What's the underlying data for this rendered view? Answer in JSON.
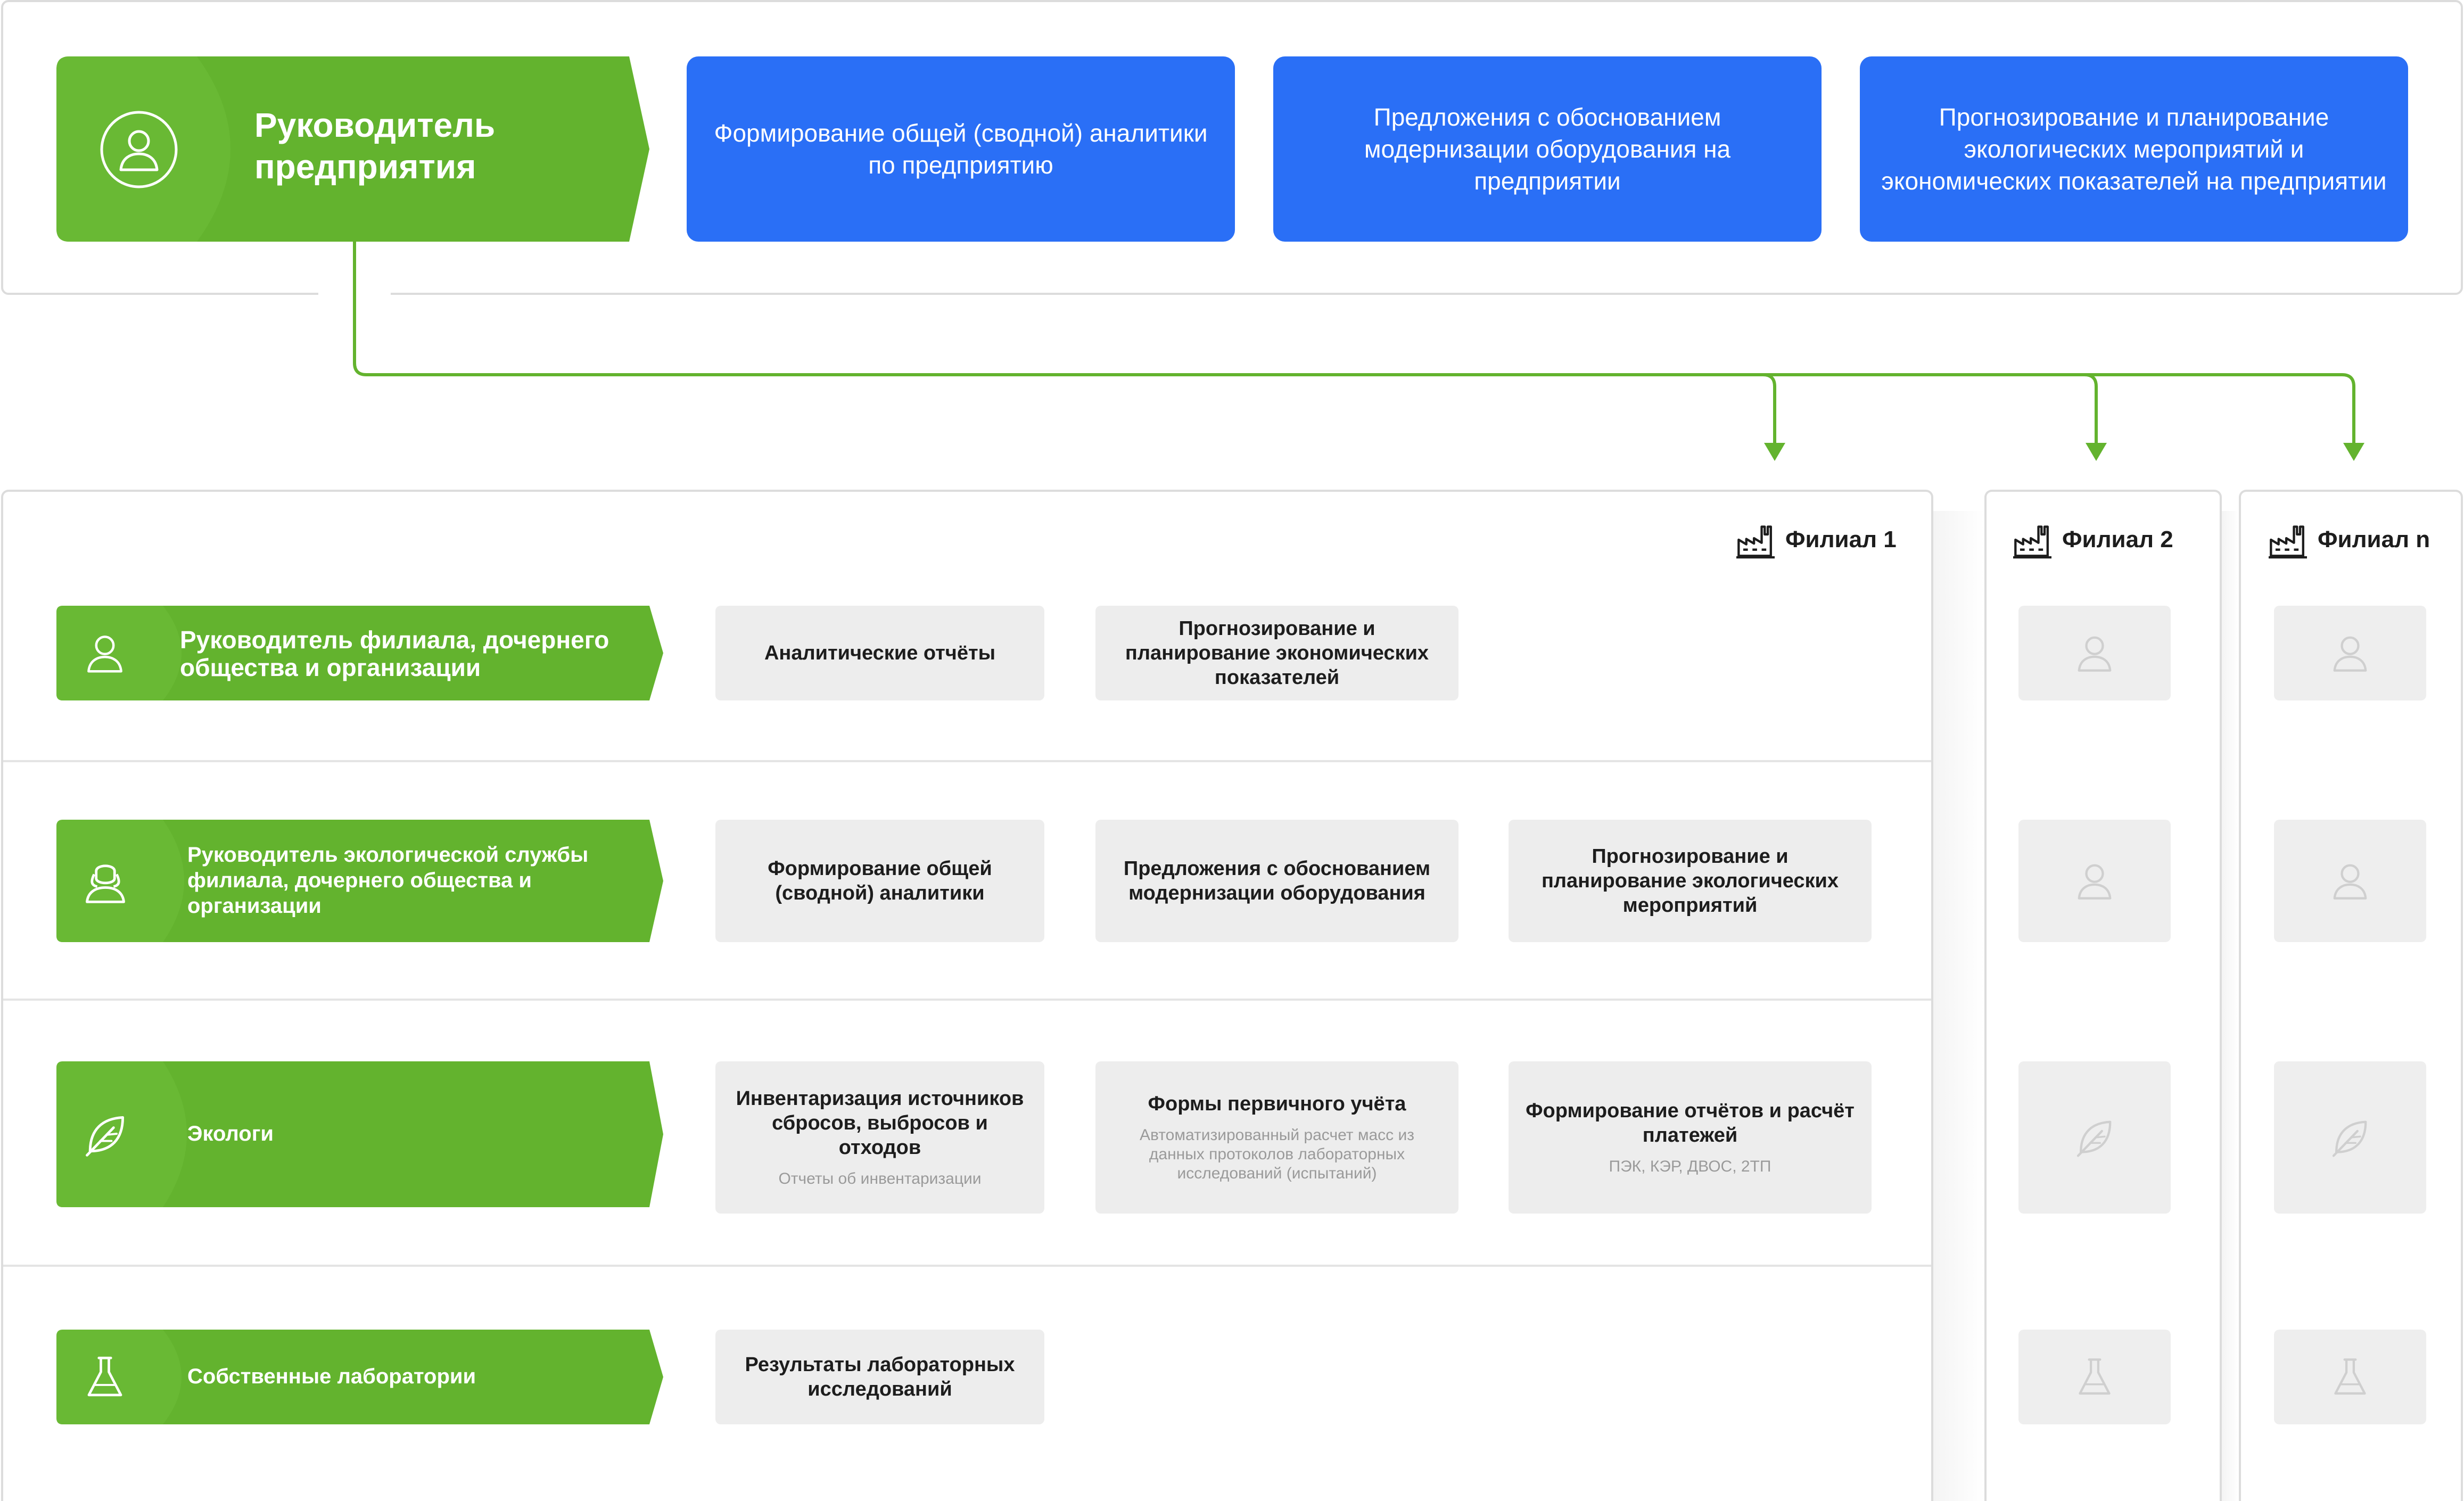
{
  "top": {
    "role": "Руководитель предприятия",
    "cards": [
      "Формирование общей (сводной) аналитики по предприятию",
      "Предложения с обоснованием модернизации оборудования на предприятии",
      "Прогнозирование и планирование экологических мероприятий и экономических показателей на предприятии"
    ]
  },
  "branches": [
    "Филиал 1",
    "Филиал 2",
    "Филиал n"
  ],
  "rows": [
    {
      "role": "Руководитель филиала, дочернего общества и организации",
      "icon": "user-icon",
      "cards": [
        {
          "title": "Аналитические отчёты",
          "sub": ""
        },
        {
          "title": "Прогнозирование и планирование экономических показателей",
          "sub": ""
        }
      ]
    },
    {
      "role": "Руководитель экологической службы филиала, дочернего общества и организации",
      "icon": "user-tie-icon",
      "cards": [
        {
          "title": "Формирование общей (сводной) аналитики",
          "sub": ""
        },
        {
          "title": "Предложения с обоснованием модернизации оборудования",
          "sub": ""
        },
        {
          "title": "Прогнозирование и планирование экологических мероприятий",
          "sub": ""
        }
      ]
    },
    {
      "role": "Экологи",
      "icon": "leaf-icon",
      "cards": [
        {
          "title": "Инвентаризация источников сбросов, выбросов и отходов",
          "sub": "Отчеты об инвентаризации"
        },
        {
          "title": "Формы первичного учёта",
          "sub": "Автоматизированный расчет масс из данных протоколов лабораторных исследований (испытаний)"
        },
        {
          "title": "Формирование отчётов и расчёт платежей",
          "sub": "ПЭК, КЭР, ДВОС, 2ТП"
        }
      ]
    },
    {
      "role": "Собственные лаборатории",
      "icon": "flask-icon",
      "cards": [
        {
          "title": "Результаты лабораторных исследований",
          "sub": ""
        }
      ]
    }
  ],
  "colors": {
    "green": "#63b32e",
    "green_dark": "#5aaa24",
    "blue": "#2a6ff6",
    "gray": "#ededed"
  }
}
